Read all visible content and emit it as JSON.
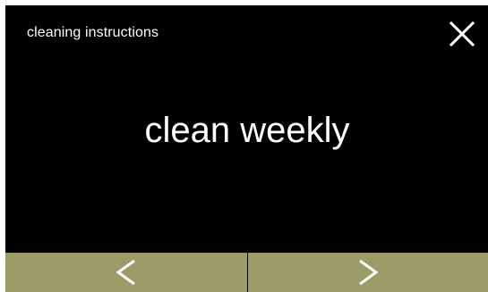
{
  "header": {
    "title": "cleaning instructions",
    "close_icon": "close-icon"
  },
  "main": {
    "message": "clean weekly"
  },
  "footer": {
    "prev_icon": "chevron-left-icon",
    "next_icon": "chevron-right-icon"
  },
  "colors": {
    "background": "#000000",
    "text": "#ffffff",
    "footer_button": "#9c9c68",
    "icon": "#ffffff"
  }
}
